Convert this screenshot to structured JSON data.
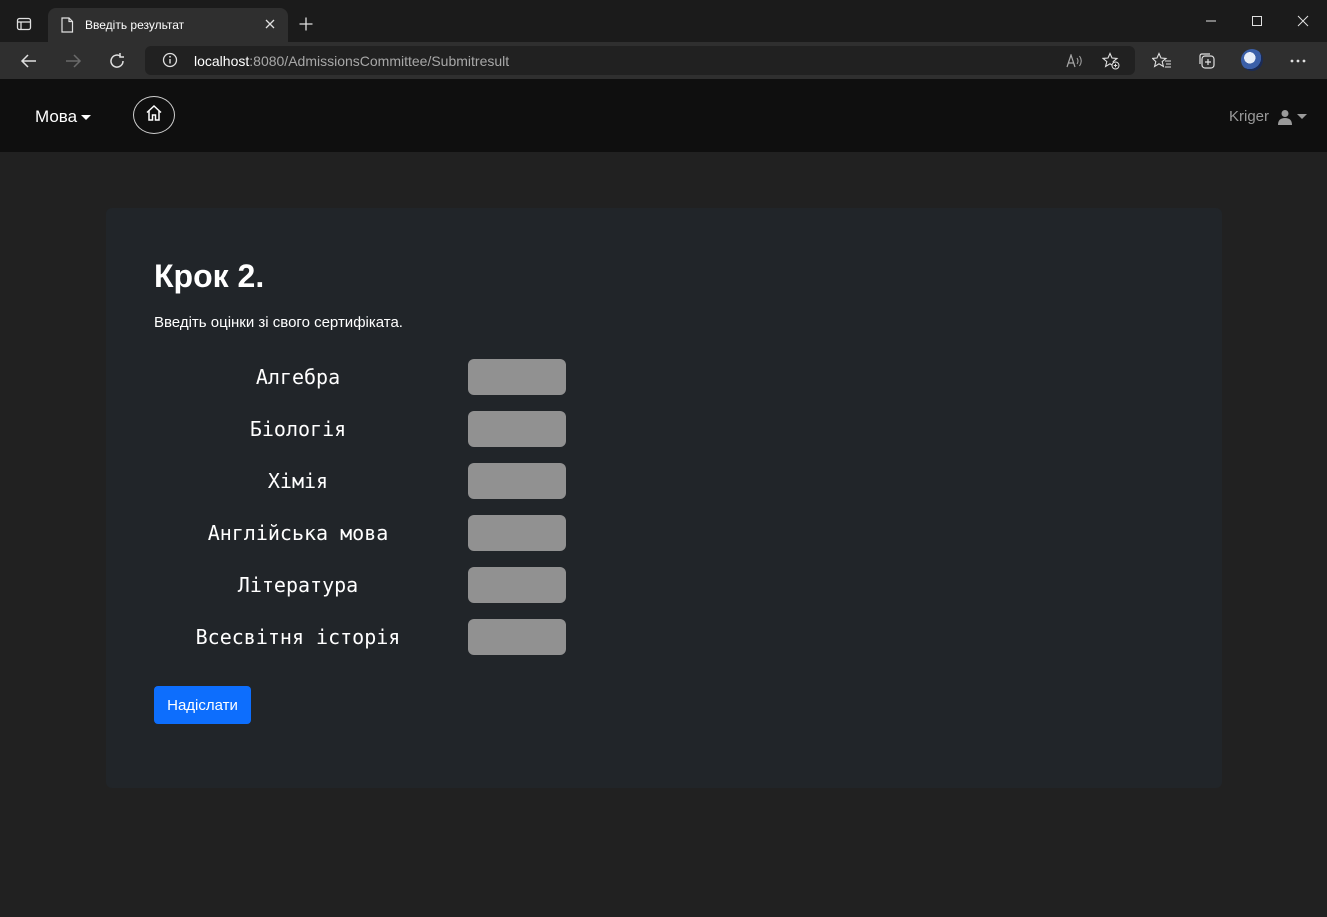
{
  "browser": {
    "tab_title": "Введіть результат",
    "url_host": "localhost",
    "url_rest": ":8080/AdmissionsCommittee/Submitresult"
  },
  "navbar": {
    "language_label": "Мова",
    "username": "Kriger"
  },
  "form": {
    "title": "Крок 2.",
    "description": "Введіть оцінки зі свого сертифіката.",
    "subjects": [
      {
        "label": "Алгебра",
        "value": ""
      },
      {
        "label": "Біологія",
        "value": ""
      },
      {
        "label": "Хімія",
        "value": ""
      },
      {
        "label": "Англійська мова",
        "value": ""
      },
      {
        "label": "Література",
        "value": ""
      },
      {
        "label": "Всесвітня історія",
        "value": ""
      }
    ],
    "submit_label": "Надіслати"
  },
  "colors": {
    "primary": "#0d6efd",
    "card_bg": "#212529",
    "page_bg": "#212121",
    "navbar_bg": "#0f0f0f",
    "input_bg": "#919191"
  }
}
